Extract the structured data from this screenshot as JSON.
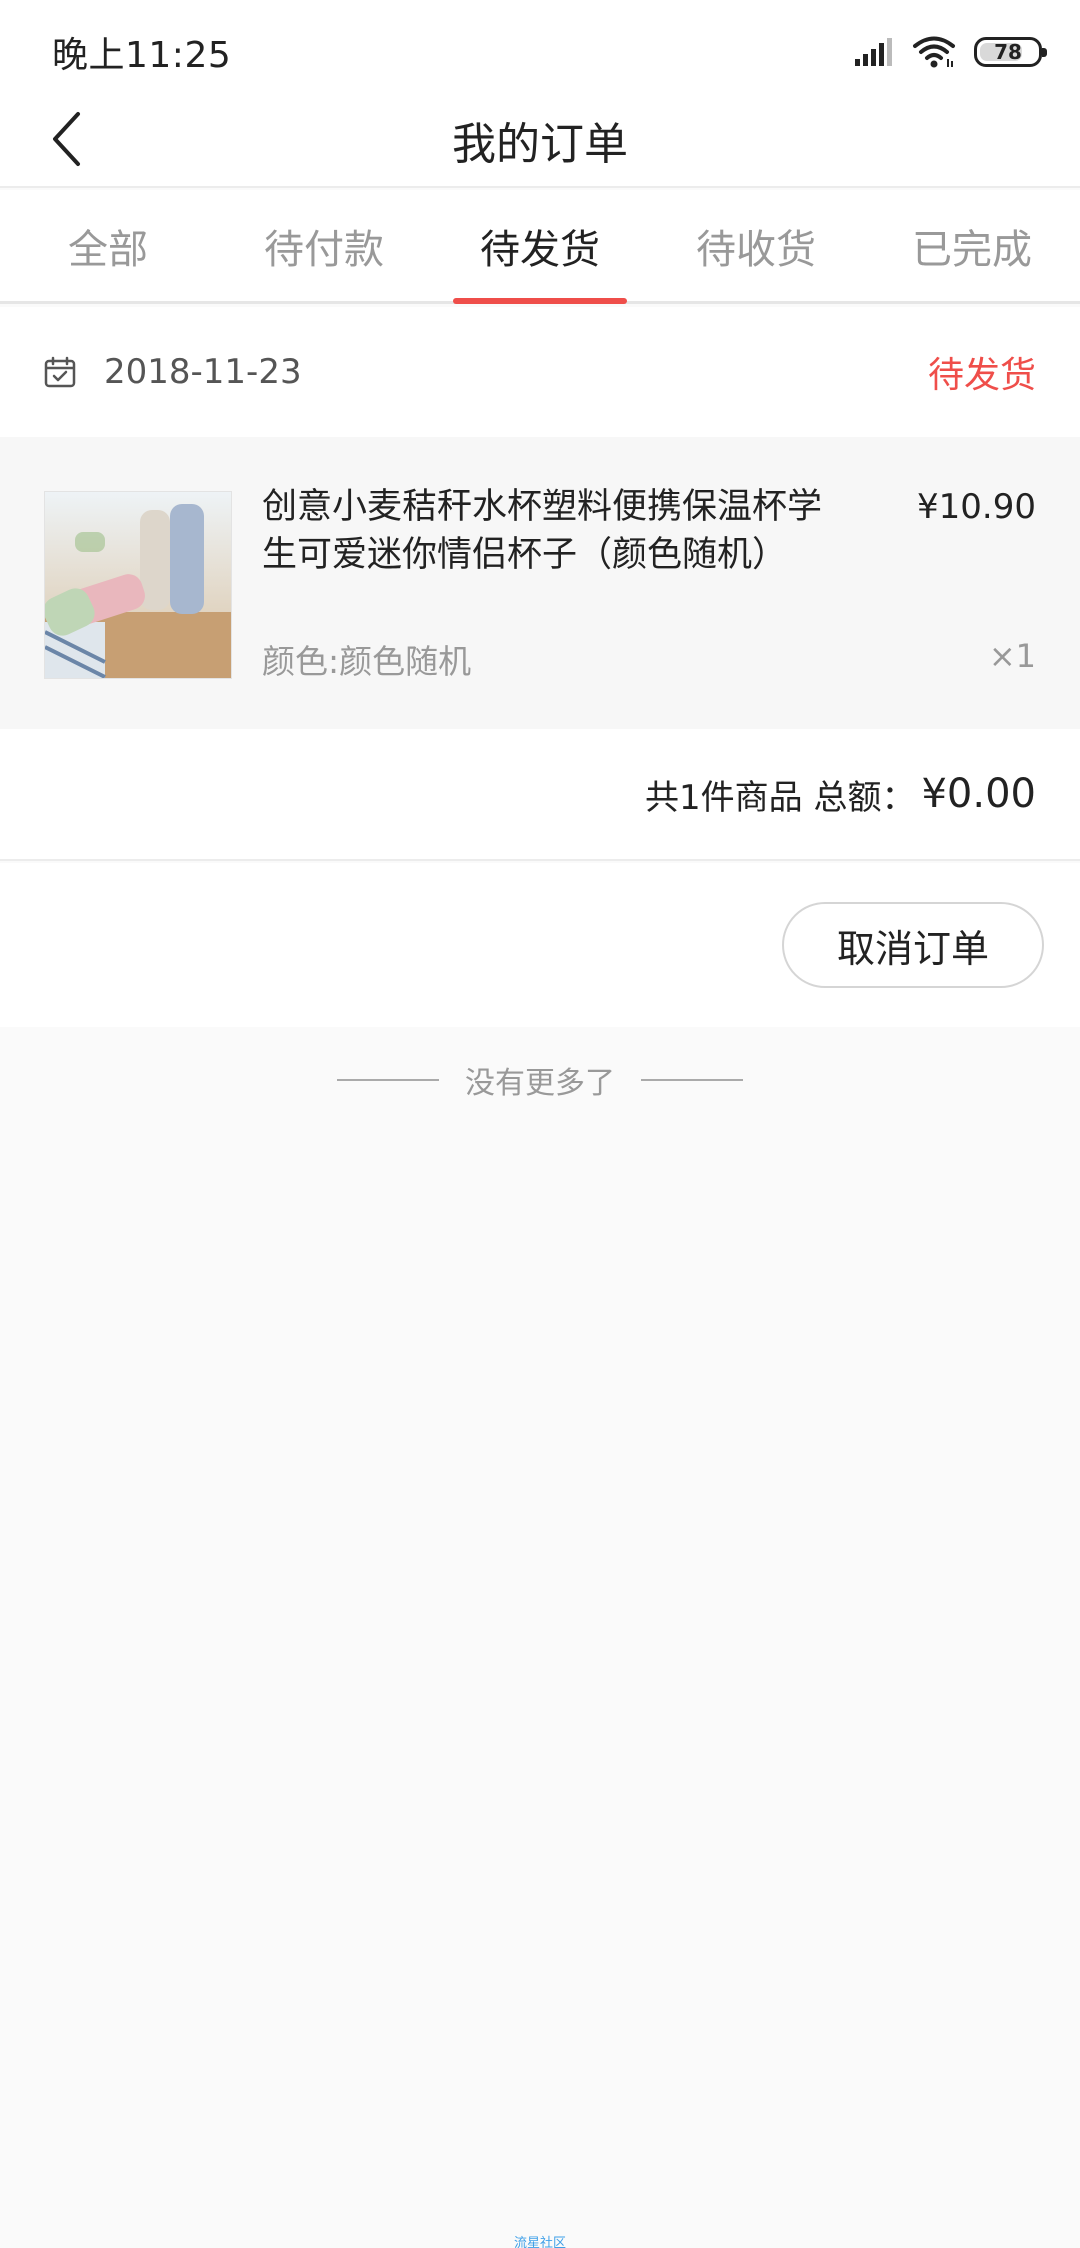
{
  "status_bar": {
    "time": "晚上11:25",
    "battery": "78",
    "battery_level_percent": 78
  },
  "header": {
    "title": "我的订单",
    "back_icon": "chevron-left-icon"
  },
  "tabs": [
    {
      "label": "全部",
      "active": false
    },
    {
      "label": "待付款",
      "active": false
    },
    {
      "label": "待发货",
      "active": true
    },
    {
      "label": "待收货",
      "active": false
    },
    {
      "label": "已完成",
      "active": false
    }
  ],
  "order": {
    "date": "2018-11-23",
    "date_icon": "calendar-icon",
    "status": "待发货",
    "product": {
      "title": "创意小麦秸秆水杯塑料便携保温杯学生可爱迷你情侣杯子（颜色随机）",
      "price": "¥10.90",
      "variant": "颜色:颜色随机",
      "quantity": "×1"
    },
    "summary_label": "共1件商品 总额：",
    "summary_total": "¥0.00",
    "cancel_label": "取消订单"
  },
  "footer": {
    "no_more": "没有更多了",
    "watermark": "流星社区"
  },
  "colors": {
    "accent": "#ef4e4a",
    "text": "#222222",
    "muted": "#999999",
    "background": "#fafafa"
  }
}
